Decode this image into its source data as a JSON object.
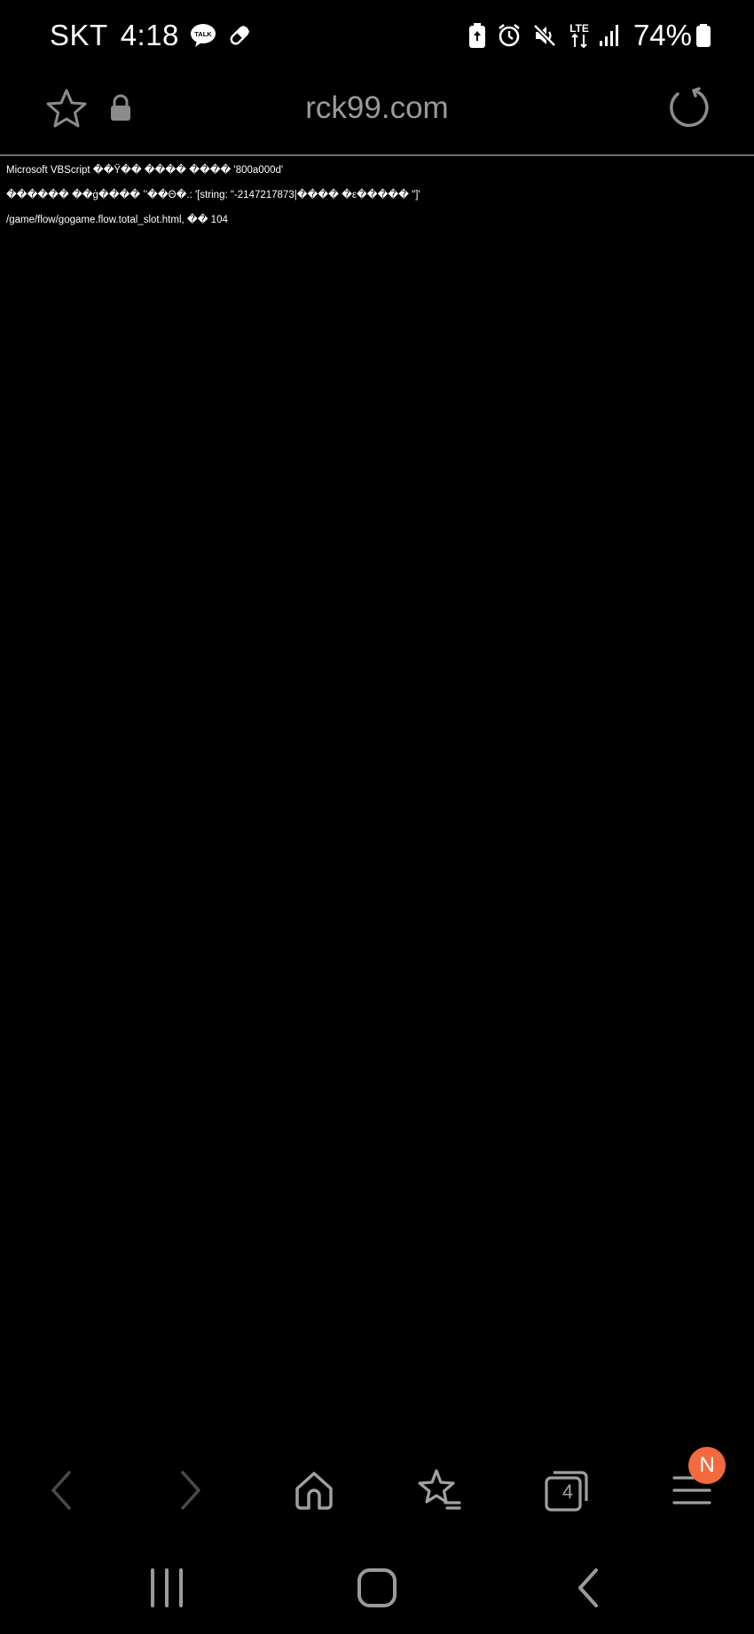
{
  "status_bar": {
    "carrier": "SKT",
    "time": "4:18",
    "notification_icons": [
      "kakaotalk-icon",
      "pill-icon"
    ],
    "system_icons": [
      "battery-saver-icon",
      "alarm-icon",
      "mute-icon",
      "lte-icon",
      "signal-icon"
    ],
    "battery_percent": "74%"
  },
  "address_bar": {
    "url": "rck99.com",
    "secure": true
  },
  "page": {
    "lines": [
      "Microsoft VBScript ��Ÿ�� ���� ���� '800a000d'",
      "������ ��ġ���� ʽ'��Θ�.: '[string: \"-2147217873|���� �ε����� \"]'",
      "/game/flow/gogame.flow.total_slot.html, �� 104"
    ]
  },
  "toolbar": {
    "tabs_count": "4",
    "menu_badge": "N"
  },
  "colors": {
    "background": "#000000",
    "url_text": "#9a9a9a",
    "icon_gray": "#8c8c8c",
    "badge": "#f26a3d"
  }
}
